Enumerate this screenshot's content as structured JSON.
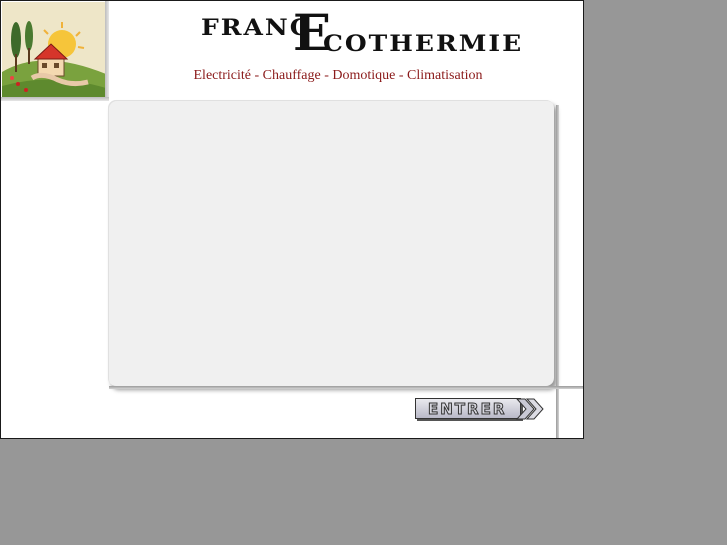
{
  "brand": {
    "logo_part_a": "FRANC",
    "logo_big_letter": "E",
    "logo_part_b": "COTHERMIE",
    "tagline": "Electricité - Chauffage - Domotique - Climatisation",
    "tagline_color": "#8b1a1a"
  },
  "illustration": {
    "icon": "house-landscape-illustration"
  },
  "navigation": {
    "enter_label": "ENTRER",
    "enter_icon": "double-chevron-right-icon"
  },
  "colors": {
    "backdrop": "#979797",
    "page": "#ffffff",
    "panel": "#f0f0f0"
  }
}
